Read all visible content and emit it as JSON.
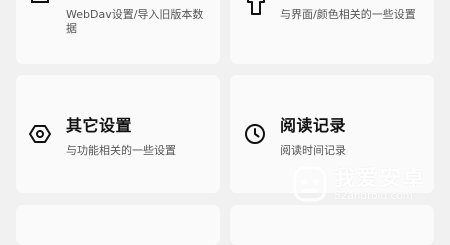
{
  "cards": [
    {
      "icon": "backup-icon",
      "title": "",
      "desc": "WebDav设置/导入旧版本数据"
    },
    {
      "icon": "shirt-icon",
      "title": "",
      "desc": "与界面/颜色相关的一些设置"
    },
    {
      "icon": "settings-hexagon-icon",
      "title": "其它设置",
      "desc": "与功能相关的一些设置"
    },
    {
      "icon": "clock-icon",
      "title": "阅读记录",
      "desc": "阅读时间记录"
    }
  ],
  "watermark": {
    "name": "我爱安卓",
    "url": "52android.com"
  }
}
